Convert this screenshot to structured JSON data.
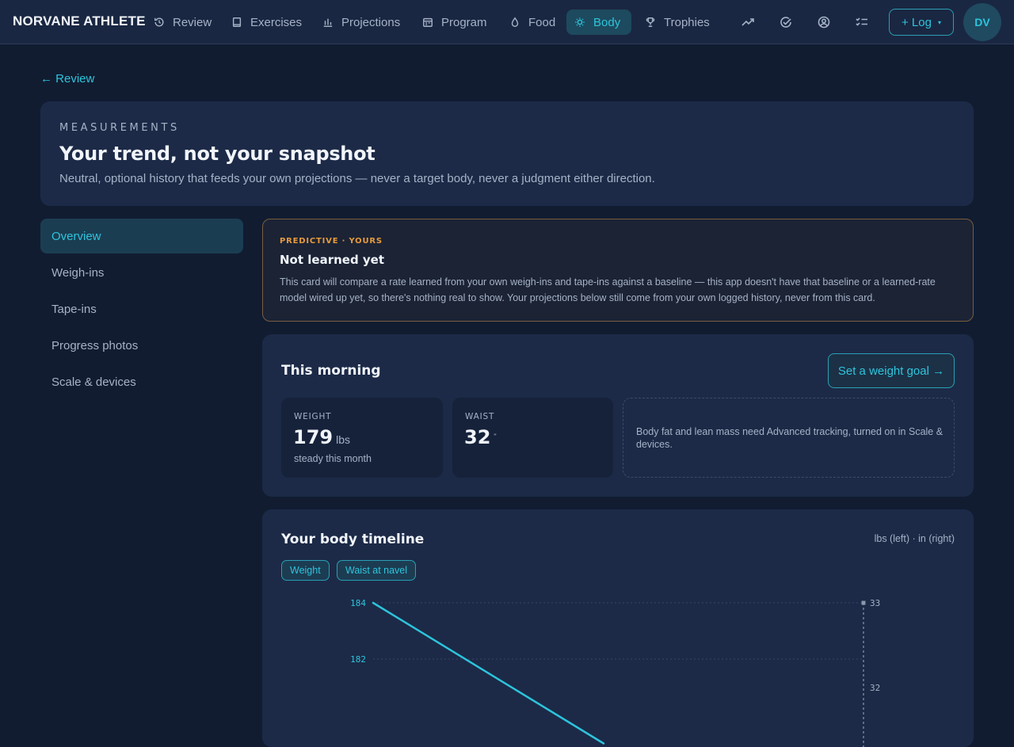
{
  "brand": "NORVANE ATHLETE",
  "nav": {
    "items": [
      {
        "label": "Review",
        "icon": "history-icon"
      },
      {
        "label": "Exercises",
        "icon": "book-icon"
      },
      {
        "label": "Projections",
        "icon": "bar-chart-icon"
      },
      {
        "label": "Program",
        "icon": "calendar-icon"
      },
      {
        "label": "Food",
        "icon": "drop-icon"
      },
      {
        "label": "Body",
        "icon": "sun-icon",
        "active": true
      },
      {
        "label": "Trophies",
        "icon": "trophy-icon"
      }
    ],
    "right_icons": [
      "trend-icon",
      "check-circle-icon",
      "user-circle-icon",
      "checklist-icon"
    ],
    "log_label": "+ Log",
    "log_caret": "▾",
    "avatar_initials": "DV"
  },
  "breadcrumb": {
    "back_label": "← Review"
  },
  "hero": {
    "eyebrow": "MEASUREMENTS",
    "title": "Your trend, not your snapshot",
    "subtitle": "Neutral, optional history that feeds your own projections — never a target body, never a judgment either direction."
  },
  "sidebar": {
    "items": [
      {
        "label": "Overview",
        "active": true
      },
      {
        "label": "Weigh-ins"
      },
      {
        "label": "Tape-ins"
      },
      {
        "label": "Progress photos"
      },
      {
        "label": "Scale & devices"
      }
    ]
  },
  "predictive": {
    "tag": "PREDICTIVE · YOURS",
    "title": "Not learned yet",
    "body": "This card will compare a rate learned from your own weigh-ins and tape-ins against a baseline — this app doesn't have that baseline or a learned-rate model wired up yet, so there's nothing real to show. Your projections below still come from your own logged history, never from this card."
  },
  "morning": {
    "title": "This morning",
    "goal_button": "Set a weight goal →",
    "weight": {
      "label": "WEIGHT",
      "value": "179",
      "unit": "lbs",
      "note": "steady this month"
    },
    "waist": {
      "label": "WAIST",
      "value": "32",
      "unit": "\""
    },
    "advanced_note": "Body fat and lean mass need Advanced tracking, turned on in Scale & devices."
  },
  "timeline": {
    "title": "Your body timeline",
    "units_note": "lbs (left) · in (right)",
    "chips": [
      "Weight",
      "Waist at navel"
    ]
  },
  "colors": {
    "accent": "#2ec4dc",
    "warning": "#e79a3c",
    "background": "#111c31",
    "card": "#1c2a47"
  },
  "chart_data": {
    "type": "line",
    "series": [
      {
        "name": "Weight",
        "axis": "left",
        "points": [
          [
            0,
            184
          ],
          [
            1,
            179
          ]
        ]
      },
      {
        "name": "Waist at navel",
        "axis": "right",
        "points": [
          [
            1,
            33
          ],
          [
            1,
            32
          ]
        ]
      }
    ],
    "left_ticks": [
      184,
      182
    ],
    "right_ticks": [
      33,
      32
    ],
    "ylim_left": [
      179,
      184
    ],
    "ylim_right": [
      32,
      33
    ]
  }
}
